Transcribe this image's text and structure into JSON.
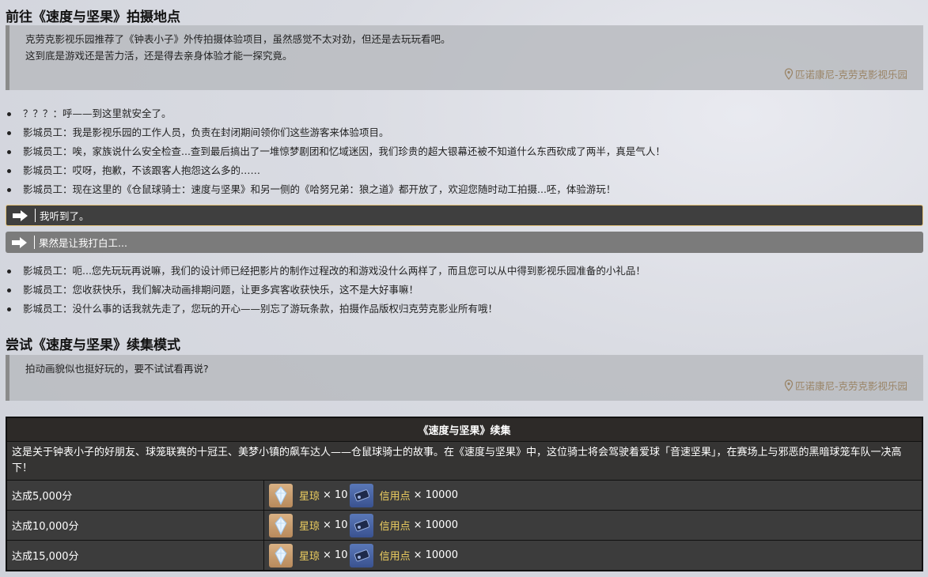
{
  "section1": {
    "title": "前往《速度与坚果》拍摄地点",
    "lines": [
      "克劳克影视乐园推荐了《钟表小子》外传拍摄体验项目，虽然感觉不太对劲，但还是去玩玩看吧。",
      "这到底是游戏还是苦力活，还是得去亲身体验才能一探究竟。"
    ],
    "location": "匹诺康尼-克劳克影视乐园"
  },
  "dialog1": [
    "？？？：呼——到这里就安全了。",
    "影城员工：我是影视乐园的工作人员，负责在封闭期间领你们这些游客来体验项目。",
    "影城员工：唉，家族说什么安全检查...查到最后搞出了一堆惊梦剧团和忆域迷因，我们珍贵的超大银幕还被不知道什么东西砍成了两半，真是气人！",
    "影城员工：哎呀，抱歉，不该跟客人抱怨这么多的……",
    "影城员工：现在这里的《仓鼠球骑士：速度与坚果》和另一侧的《哈努兄弟：狼之道》都开放了，欢迎您随时动工拍摄...呸，体验游玩！"
  ],
  "options": {
    "selected": "我听到了。",
    "other": "果然是让我打白工..."
  },
  "dialog2": [
    "影城员工：呃...您先玩玩再说嘛，我们的设计师已经把影片的制作过程改的和游戏没什么两样了，而且您可以从中得到影视乐园准备的小礼品！",
    "影城员工：您收获快乐，我们解决动画排期问题，让更多宾客收获快乐，这不是大好事嘛！",
    "影城员工：没什么事的话我就先走了，您玩的开心——别忘了游玩条款，拍摄作品版权归克劳克影业所有哦！"
  ],
  "section2": {
    "title": "尝试《速度与坚果》续集模式",
    "lines": [
      "拍动画貌似也挺好玩的，要不试试看再说?"
    ],
    "location": "匹诺康尼-克劳克影视乐园"
  },
  "table": {
    "title": "《速度与坚果》续集",
    "description": "这是关于钟表小子的好朋友、球笼联赛的十冠王、美梦小镇的飙车达人——仓鼠球骑士的故事。在《速度与坚果》中，这位骑士将会驾驶着爱球「音速坚果」，在赛场上与邪恶的黑暗球笼车队一决高下！",
    "rows": [
      {
        "label": "达成5,000分",
        "r1_name": "星琼",
        "r1_qty": "× 10",
        "r2_name": "信用点",
        "r2_qty": "× 10000"
      },
      {
        "label": "达成10,000分",
        "r1_name": "星琼",
        "r1_qty": "× 10",
        "r2_name": "信用点",
        "r2_qty": "× 10000"
      },
      {
        "label": "达成15,000分",
        "r1_name": "星琼",
        "r1_qty": "× 10",
        "r2_name": "信用点",
        "r2_qty": "× 10000"
      }
    ]
  },
  "icons": {
    "location": "map-pin-icon",
    "option": "arrow-right-icon",
    "reward1": "stellar-jade-icon",
    "reward2": "credit-icon"
  },
  "colors": {
    "location_text": "#9a8466",
    "reward_name": "#f0d060",
    "option_selected_border": "#e6c47a"
  }
}
